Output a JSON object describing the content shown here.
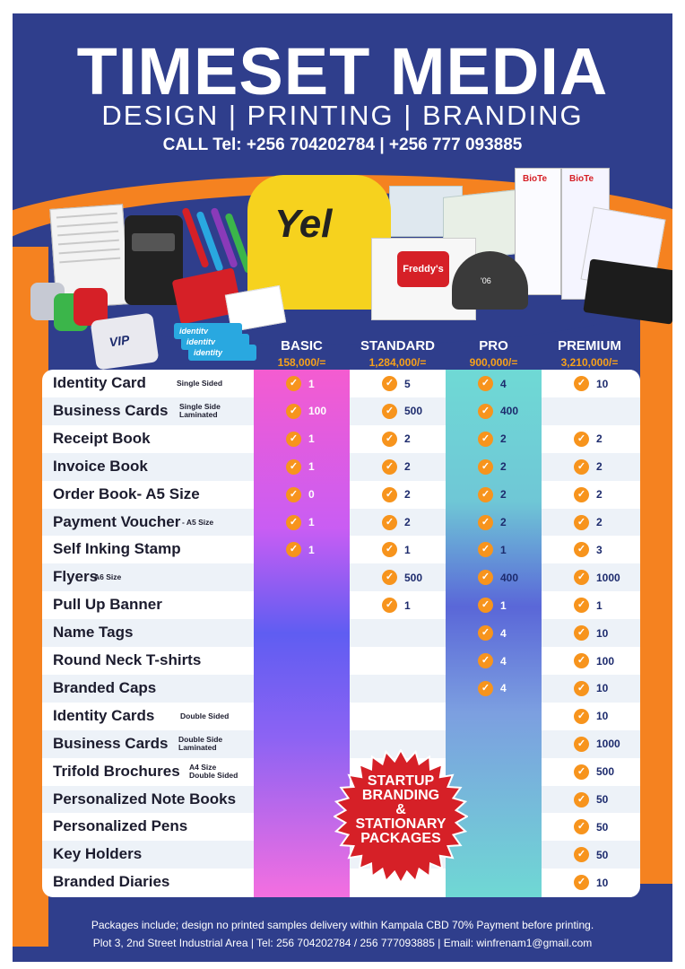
{
  "header": {
    "title": "TIMESET MEDIA",
    "subtitle": "DESIGN | PRINTING | BRANDING",
    "phone": "CALL Tel: +256 704202784 | +256 777 093885"
  },
  "product_art": {
    "tshirt_text": "Yel",
    "notebook_logo": "Freddy's",
    "cap_text": "'06",
    "banner_text": "BioTe",
    "vip_text": "VIP",
    "card_text": "identity"
  },
  "packages": [
    {
      "name": "BASIC",
      "price": "158,000/="
    },
    {
      "name": "STANDARD",
      "price": "1,284,000/="
    },
    {
      "name": "PRO",
      "price": "900,000/="
    },
    {
      "name": "PREMIUM",
      "price": "3,210,000/="
    }
  ],
  "rows": [
    {
      "label": "Identity Card",
      "note": "Single Sided",
      "basic": "1",
      "standard": "5",
      "pro": "4",
      "premium": "10"
    },
    {
      "label": "Business Cards",
      "note": "Single Side\nLaminated",
      "basic": "100",
      "standard": "500",
      "pro": "400",
      "premium": ""
    },
    {
      "label": "Receipt Book",
      "note": "",
      "basic": "1",
      "standard": "2",
      "pro": "2",
      "premium": "2"
    },
    {
      "label": "Invoice Book",
      "note": "",
      "basic": "1",
      "standard": "2",
      "pro": "2",
      "premium": "2"
    },
    {
      "label": "Order Book- A5 Size",
      "note": "",
      "basic": "0",
      "standard": "2",
      "pro": "2",
      "premium": "2"
    },
    {
      "label": "Payment Voucher",
      "note": "- A5 Size",
      "basic": "1",
      "standard": "2",
      "pro": "2",
      "premium": "2"
    },
    {
      "label": "Self Inking Stamp",
      "note": "",
      "basic": "1",
      "standard": "1",
      "pro": "1",
      "premium": "3"
    },
    {
      "label": "Flyers",
      "note": "A6 Size",
      "basic": "",
      "standard": "500",
      "pro": "400",
      "premium": "1000"
    },
    {
      "label": "Pull Up Banner",
      "note": "",
      "basic": "",
      "standard": "1",
      "pro": "1",
      "premium": "1"
    },
    {
      "label": "Name Tags",
      "note": "",
      "basic": "",
      "standard": "",
      "pro": "4",
      "premium": "10"
    },
    {
      "label": "Round Neck T-shirts",
      "note": "",
      "basic": "",
      "standard": "",
      "pro": "4",
      "premium": "100"
    },
    {
      "label": "Branded Caps",
      "note": "",
      "basic": "",
      "standard": "",
      "pro": "4",
      "premium": "10"
    },
    {
      "label": "Identity Cards",
      "note": "Double Sided",
      "basic": "",
      "standard": "",
      "pro": "",
      "premium": "10"
    },
    {
      "label": "Business Cards",
      "note": "Double Side\nLaminated",
      "basic": "",
      "standard": "",
      "pro": "",
      "premium": "1000"
    },
    {
      "label": "Trifold Brochures",
      "note": "A4 Size\nDouble Sided",
      "basic": "",
      "standard": "",
      "pro": "",
      "premium": "500"
    },
    {
      "label": "Personalized Note Books",
      "note": "",
      "basic": "",
      "standard": "",
      "pro": "",
      "premium": "50"
    },
    {
      "label": "Personalized Pens",
      "note": "",
      "basic": "",
      "standard": "",
      "pro": "",
      "premium": "50"
    },
    {
      "label": "Key Holders",
      "note": "",
      "basic": "",
      "standard": "",
      "pro": "",
      "premium": "50"
    },
    {
      "label": "Branded Diaries",
      "note": "",
      "basic": "",
      "standard": "",
      "pro": "",
      "premium": "10"
    }
  ],
  "badge": {
    "lines": [
      "STARTUP",
      "BRANDING",
      "&",
      "STATIONARY",
      "PACKAGES"
    ],
    "color": "#d62027"
  },
  "footer": {
    "line1": "Packages include; design no printed samples delivery within Kampala CBD 70% Payment before printing.",
    "line2": "Plot 3, 2nd Street Industrial Area | Tel: 256 704202784 / 256 777093885 | Email: winfrenam1@gmail.com"
  },
  "colors": {
    "navy": "#2f3e8c",
    "orange": "#f58220",
    "check": "#f7941d",
    "price": "#f7a11a"
  },
  "icons": {
    "check": "check-circle-icon"
  }
}
